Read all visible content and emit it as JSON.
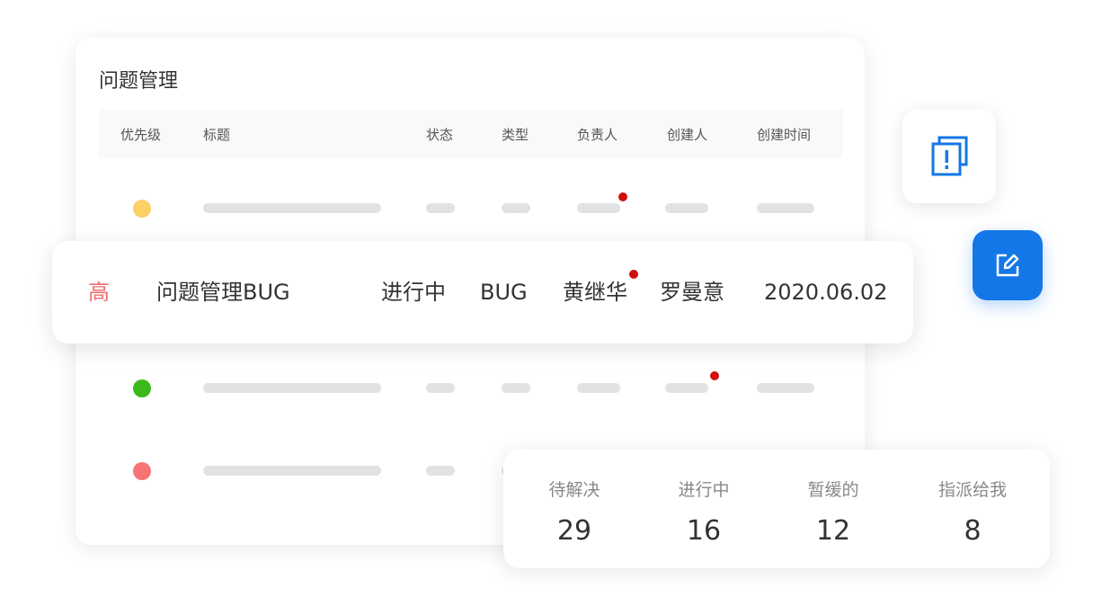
{
  "card": {
    "title": "问题管理",
    "columns": [
      "优先级",
      "标题",
      "状态",
      "类型",
      "负责人",
      "创建人",
      "创建时间"
    ],
    "placeholder_rows": [
      {
        "priority_color": "#fdd066",
        "flag_column": "负责人"
      },
      {
        "priority_color": "#3bb91a",
        "flag_column": "创建人"
      },
      {
        "priority_color": "#f87373",
        "flag_column": null
      }
    ]
  },
  "highlight_row": {
    "priority": "高",
    "title": "问题管理BUG",
    "status": "进行中",
    "type": "BUG",
    "assignee": "黄继华",
    "creator": "罗曼意",
    "created_at": "2020.06.02"
  },
  "actions": {
    "issues_icon": "issues-stack-icon",
    "edit_icon": "edit-icon"
  },
  "stats": [
    {
      "label": "待解决",
      "value": "29"
    },
    {
      "label": "进行中",
      "value": "16"
    },
    {
      "label": "暂缓的",
      "value": "12"
    },
    {
      "label": "指派给我",
      "value": "8"
    }
  ],
  "colors": {
    "accent": "#1477e8",
    "priority_high": "#f26d6d",
    "notification_dot": "#d00f0f"
  }
}
